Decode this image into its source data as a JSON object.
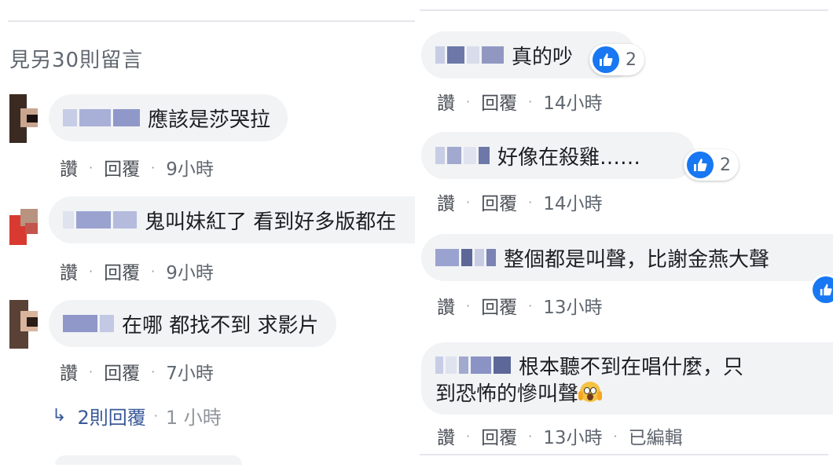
{
  "left": {
    "view_more": "見另30則留言",
    "comments": [
      {
        "text": "應該是莎哭拉",
        "reply": "回覆",
        "like": "讚",
        "time": "9小時"
      },
      {
        "text": "鬼叫妹紅了 看到好多版都在",
        "reply": "回覆",
        "like": "讚",
        "time": "9小時"
      },
      {
        "text": "在哪 都找不到 求影片",
        "reply": "回覆",
        "like": "讚",
        "time": "7小時"
      }
    ],
    "replies": {
      "label": "2則回覆",
      "time": "1 小時"
    }
  },
  "right": {
    "comments": [
      {
        "text": "真的吵",
        "like": "讚",
        "reply": "回覆",
        "time": "14小時",
        "reaction_count": "2"
      },
      {
        "text": "好像在殺雞……",
        "like": "讚",
        "reply": "回覆",
        "time": "14小時",
        "reaction_count": "2"
      },
      {
        "text": "整個都是叫聲，比謝金燕大聲",
        "like": "讚",
        "reply": "回覆",
        "time": "13小時"
      },
      {
        "text_line1": "根本聽不到在唱什麼，只",
        "text_line2": "到恐怖的慘叫聲",
        "like": "讚",
        "reply": "回覆",
        "time": "13小時",
        "edited": "已編輯"
      }
    ]
  },
  "colors": {
    "like_blue": "#1877f2",
    "bubble_bg": "#f2f3f5",
    "meta_gray": "#606770",
    "link_blue": "#385898"
  },
  "icons": [
    "like-thumb-icon",
    "reply-arrow-icon",
    "scream-emoji-icon"
  ]
}
